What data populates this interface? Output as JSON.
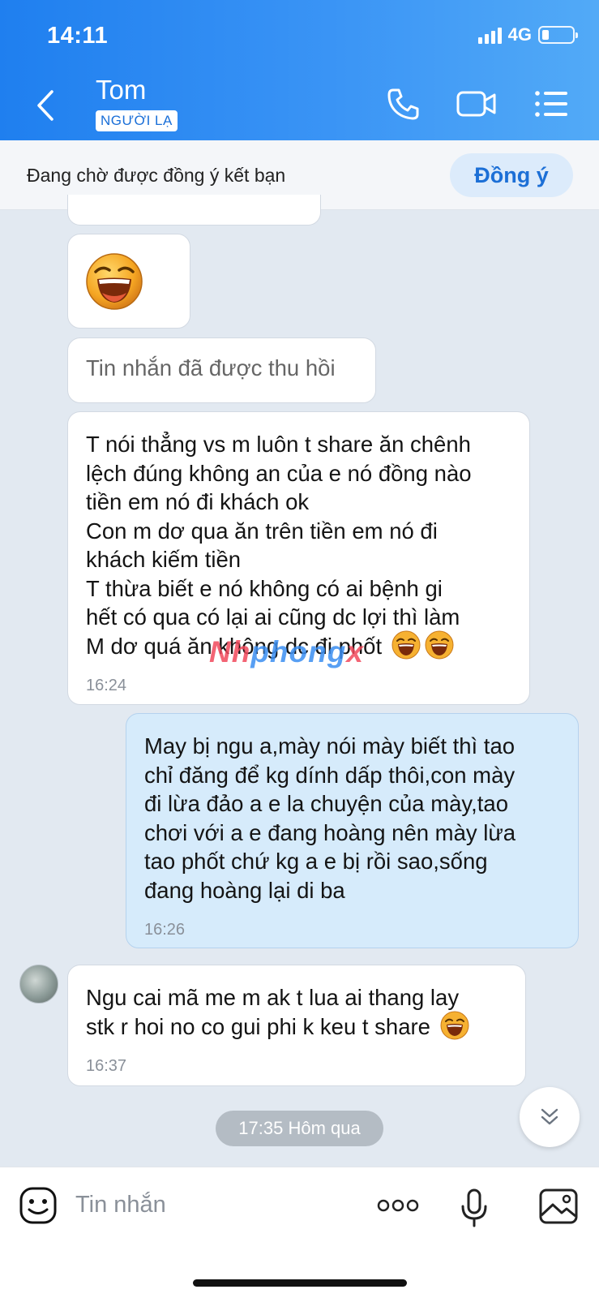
{
  "status_bar": {
    "time": "14:11",
    "network": "4G",
    "battery_level": 0.2
  },
  "header": {
    "contact_name": "Tom",
    "badge": "NGƯỜI LẠ"
  },
  "friend_request": {
    "text": "Đang chờ được đồng ý kết bạn",
    "accept_label": "Đồng ý"
  },
  "messages": [
    {
      "text": "Tin nhắn đã được thu hồi"
    },
    {
      "text": "T nói thẳng vs m luôn t share ăn chênh\nlệch đúng không an của e nó đồng nào\ntiền em nó đi khách ok\nCon m dơ qua ăn trên tiền em nó đi\nkhách kiếm tiền\nT thừa biết e nó không có ai bệnh gi\nhết có qua có lại ai cũng dc lợi thì làm\nM dơ quá ăn không dc đi phốt",
      "time": "16:24"
    },
    {
      "text": "May bị ngu a,mày nói mày biết thì tao\nchỉ đăng để kg dính dấp thôi,con mày\nđi lừa đảo a e la chuyện của mày,tao\nchơi với a e đang hoàng nên mày lừa\ntao phốt chứ kg a e bị rồi sao,sống\nđang hoàng lại di ba",
      "time": "16:26"
    },
    {
      "text": "Ngu cai mã me m ak t lua ai thang lay\nstk r hoi no co gui phi k keu t share",
      "time": "16:37"
    }
  ],
  "watermark": {
    "part1": "Nh",
    "part2": "phong",
    "part3": "x"
  },
  "time_separator": "17:35 Hôm qua",
  "composer": {
    "placeholder": "Tin nhắn"
  },
  "colors": {
    "header_gradient_start": "#1f7fef",
    "header_gradient_end": "#52aaf7",
    "my_bubble": "#d6ebfb",
    "accent": "#1c6fd6"
  }
}
